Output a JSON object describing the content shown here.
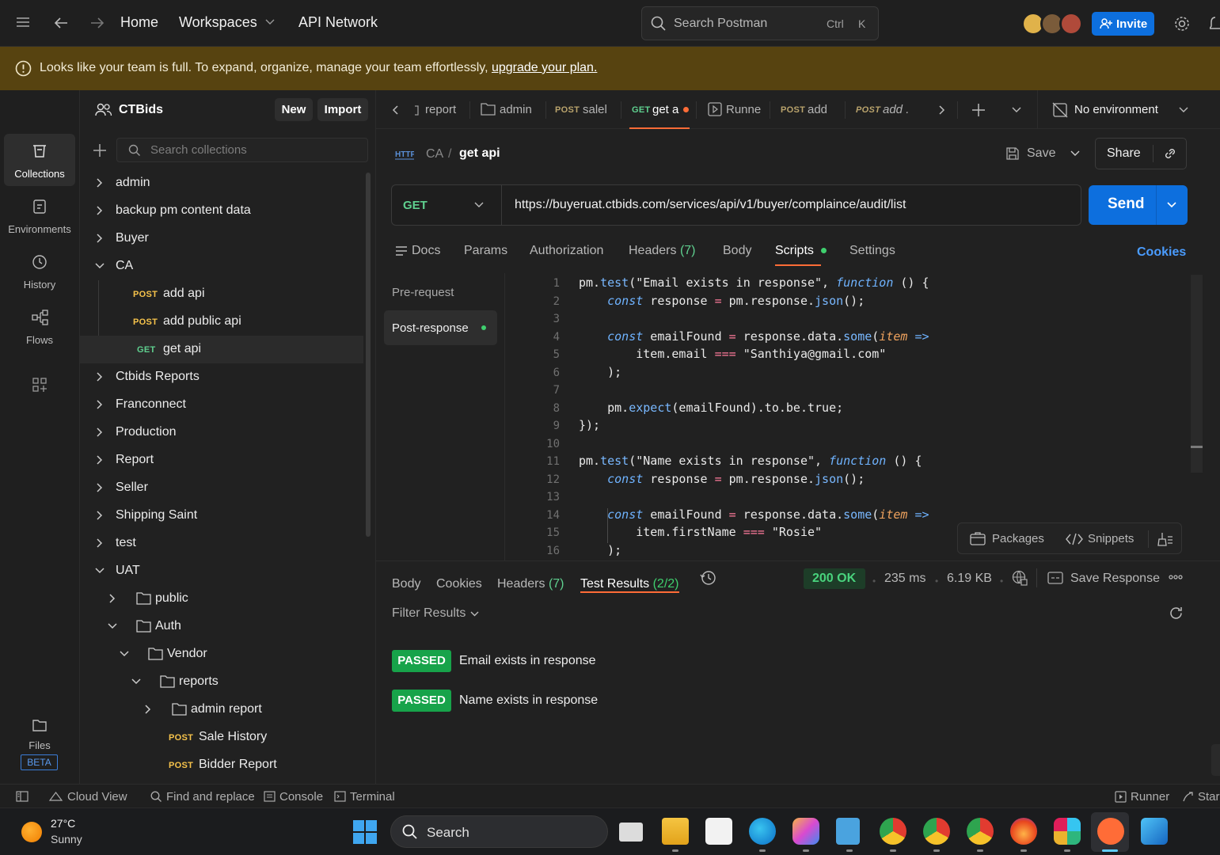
{
  "topbar": {
    "home": "Home",
    "workspaces": "Workspaces",
    "api_network": "API Network",
    "search_placeholder": "Search Postman",
    "shortcut_ctrl": "Ctrl",
    "shortcut_k": "K",
    "invite": "Invite"
  },
  "banner": {
    "text": "Looks like your team is full. To expand, organize, manage your team effortlessly, ",
    "link": "upgrade your plan."
  },
  "rail": {
    "collections": "Collections",
    "environments": "Environments",
    "history": "History",
    "flows": "Flows",
    "files": "Files",
    "beta": "BETA"
  },
  "workspace": {
    "name": "CTBids",
    "new": "New",
    "import": "Import",
    "search_placeholder": "Search collections"
  },
  "tree": [
    {
      "label": "admin"
    },
    {
      "label": "backup pm content data"
    },
    {
      "label": "Buyer"
    },
    {
      "label": "CA"
    },
    {
      "method": "POST",
      "label": "add api"
    },
    {
      "method": "POST",
      "label": "add public api"
    },
    {
      "method": "GET",
      "label": "get api"
    },
    {
      "label": "Ctbids Reports"
    },
    {
      "label": "Franconnect"
    },
    {
      "label": "Production"
    },
    {
      "label": "Report"
    },
    {
      "label": "Seller"
    },
    {
      "label": "Shipping Saint"
    },
    {
      "label": "test"
    },
    {
      "label": "UAT"
    },
    {
      "label": "public"
    },
    {
      "label": "Auth"
    },
    {
      "label": "Vendor"
    },
    {
      "label": "reports"
    },
    {
      "label": "admin report"
    },
    {
      "method": "POST",
      "label": "Sale History"
    },
    {
      "method": "POST",
      "label": "Bidder Report"
    }
  ],
  "tabs": [
    {
      "label": "report"
    },
    {
      "label": "admin"
    },
    {
      "method": "POST",
      "label": "salel"
    },
    {
      "method": "GET",
      "label": "get a"
    },
    {
      "label": "Runne"
    },
    {
      "method": "POST",
      "label": "add"
    },
    {
      "method": "POST",
      "label": "add ."
    }
  ],
  "environment": "No environment",
  "request": {
    "breadcrumb_parent": "CA",
    "breadcrumb_sep": "/",
    "name": "get api",
    "save": "Save",
    "share": "Share",
    "method": "GET",
    "url": "https://buyeruat.ctbids.com/services/api/v1/buyer/complaince/audit/list",
    "send": "Send",
    "tabs": {
      "docs": "Docs",
      "params": "Params",
      "authorization": "Authorization",
      "headers": "Headers",
      "headers_count": "(7)",
      "body": "Body",
      "scripts": "Scripts",
      "settings": "Settings",
      "cookies": "Cookies"
    },
    "script_tabs": {
      "pre": "Pre-request",
      "post": "Post-response"
    }
  },
  "code_lines": [
    "1",
    "2",
    "3",
    "4",
    "5",
    "6",
    "7",
    "8",
    "9",
    "10",
    "11",
    "12",
    "13",
    "14",
    "15",
    "16"
  ],
  "editor_tools": {
    "packages": "Packages",
    "snippets": "Snippets"
  },
  "response": {
    "tabs": {
      "body": "Body",
      "cookies": "Cookies",
      "headers": "Headers",
      "headers_count": "(7)",
      "test_results": "Test Results",
      "test_count": "(2/2)"
    },
    "status": "200 OK",
    "time": "235 ms",
    "size": "6.19 KB",
    "save_response": "Save Response",
    "filter": "Filter Results",
    "tests": [
      {
        "status": "PASSED",
        "name": "Email exists in response"
      },
      {
        "status": "PASSED",
        "name": "Name exists in response"
      }
    ]
  },
  "statusbar": {
    "cloud_view": "Cloud View",
    "find_replace": "Find and replace",
    "console": "Console",
    "terminal": "Terminal",
    "runner": "Runner",
    "start": "Star"
  },
  "taskbar": {
    "temp": "27°C",
    "weather": "Sunny",
    "search": "Search"
  },
  "colors": {
    "accent": "#ff6c37",
    "send": "#0d6fde",
    "passed": "#17a34a",
    "banner": "#574310"
  }
}
